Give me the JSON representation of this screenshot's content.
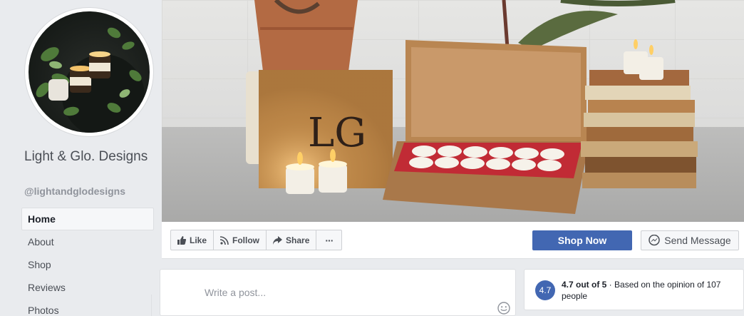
{
  "page": {
    "name": "Light & Glo. Designs",
    "handle": "@lightandglodesigns"
  },
  "nav": {
    "items": [
      {
        "label": "Home",
        "active": true
      },
      {
        "label": "About",
        "active": false
      },
      {
        "label": "Shop",
        "active": false
      },
      {
        "label": "Reviews",
        "active": false
      },
      {
        "label": "Photos",
        "active": false
      }
    ]
  },
  "cover": {
    "box_lettering": "LG"
  },
  "actions": {
    "like_label": "Like",
    "follow_label": "Follow",
    "share_label": "Share",
    "more_label": "···",
    "shop_now_label": "Shop Now",
    "send_message_label": "Send Message"
  },
  "composer": {
    "placeholder": "Write a post..."
  },
  "rating": {
    "score": "4.7",
    "score_text": "4.7 out of 5",
    "separator": " · ",
    "basis_text": "Based on the opinion of 107 people"
  },
  "colors": {
    "accent": "#4267b2",
    "background": "#e9ebee"
  }
}
